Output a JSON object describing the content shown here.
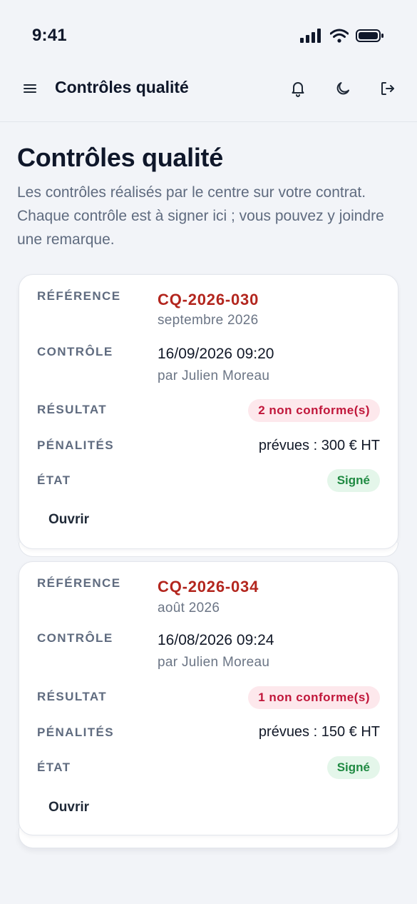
{
  "status": {
    "time": "9:41"
  },
  "header": {
    "title": "Contrôles qualité"
  },
  "page": {
    "title": "Contrôles qualité",
    "description": "Les contrôles réalisés par le centre sur votre contrat. Chaque contrôle est à signer ici ; vous pouvez y joindre une remarque."
  },
  "labels": {
    "reference": "RÉFÉRENCE",
    "controle": "CONTRÔLE",
    "resultat": "RÉSULTAT",
    "penalites": "PÉNALITÉS",
    "etat": "ÉTAT",
    "open": "Ouvrir"
  },
  "controls": [
    {
      "reference": "CQ-2026-030",
      "period": "septembre 2026",
      "datetime": "16/09/2026 09:20",
      "by": "par Julien Moreau",
      "result": "2 non conforme(s)",
      "penalty": "prévues : 300 € HT",
      "state": "Signé"
    },
    {
      "reference": "CQ-2026-034",
      "period": "août 2026",
      "datetime": "16/08/2026 09:24",
      "by": "par Julien Moreau",
      "result": "1 non conforme(s)",
      "penalty": "prévues : 150 € HT",
      "state": "Signé"
    }
  ],
  "colors": {
    "accent_red": "#b3261e",
    "badge_red_bg": "#fde8ec",
    "badge_green_bg": "#e4f6ea",
    "badge_green_text": "#1f8a42"
  },
  "icons": [
    "signal-icon",
    "wifi-icon",
    "battery-icon",
    "menu-icon",
    "bell-icon",
    "moon-icon",
    "logout-icon"
  ]
}
